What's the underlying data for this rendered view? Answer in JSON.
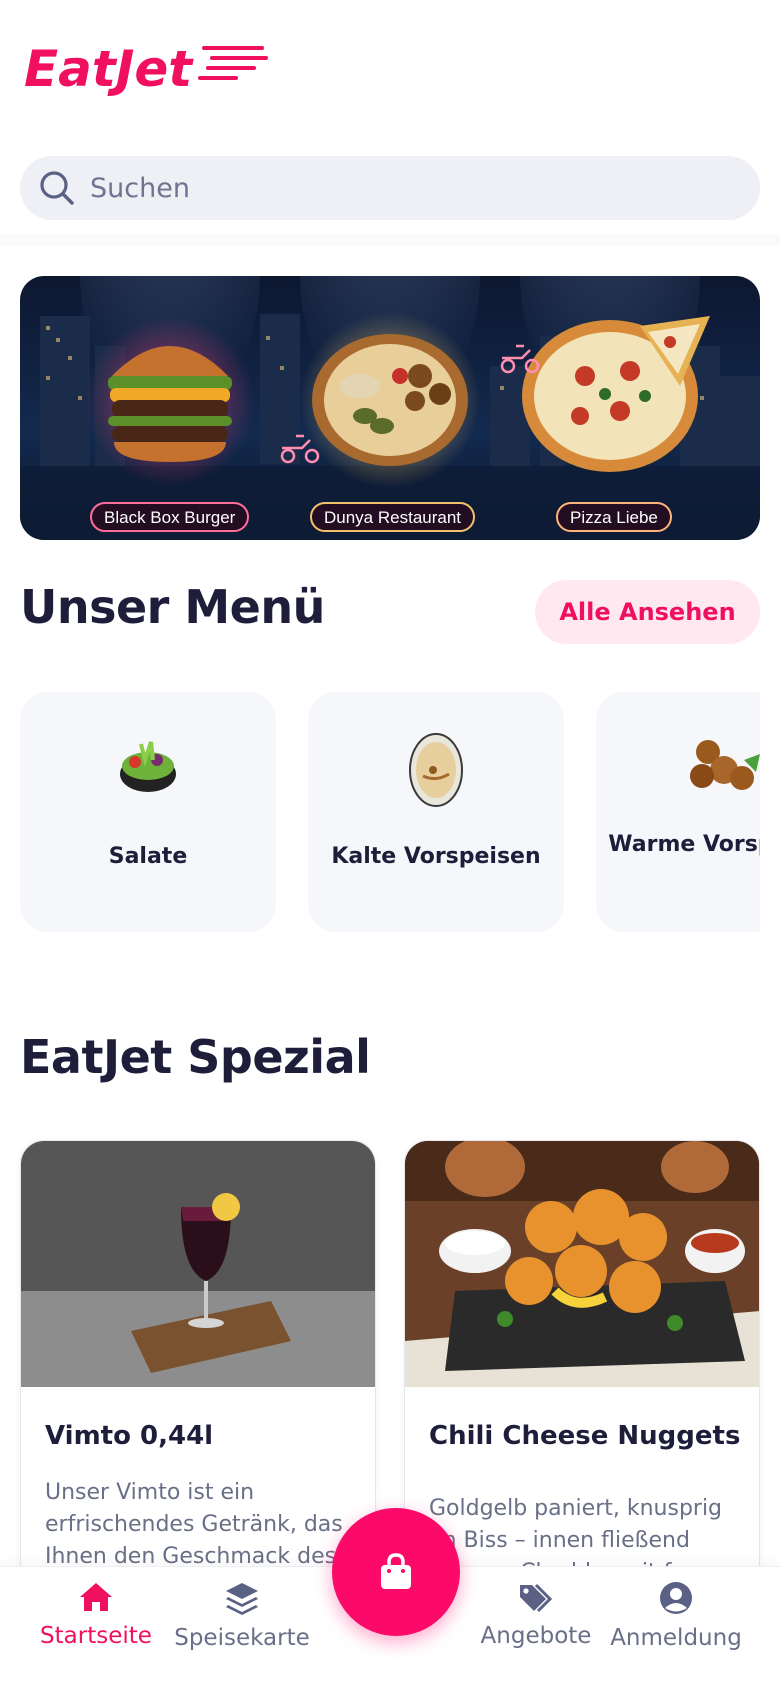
{
  "brand": {
    "logo_text": "EatJet",
    "accent": "#f0105f"
  },
  "search": {
    "placeholder": "Suchen",
    "icon": "search-icon"
  },
  "banner": {
    "labels": [
      "Black Box Burger",
      "Dunya Restaurant",
      "Pizza Liebe"
    ]
  },
  "menu": {
    "title": "Unser Menü",
    "see_all": "Alle Ansehen",
    "categories": [
      {
        "label": "Salate"
      },
      {
        "label": "Kalte Vorspeisen"
      },
      {
        "label": "Warme Vorspeisen"
      }
    ]
  },
  "special": {
    "title": "EatJet Spezial",
    "items": [
      {
        "name": "Vimto 0,44l",
        "desc": "Unser Vimto ist ein erfrischendes Getränk, das Ihnen den Geschmack des"
      },
      {
        "name": "Chili Cheese Nuggets",
        "desc": "Goldgelb paniert, knusprig im Biss – innen fließend warmer Cheddar mit feur"
      }
    ]
  },
  "nav": {
    "items": [
      {
        "label": "Startseite",
        "icon": "home-icon",
        "active": true
      },
      {
        "label": "Speisekarte",
        "icon": "layers-icon",
        "active": false
      },
      {
        "label": "Angebote",
        "icon": "tags-icon",
        "active": false
      },
      {
        "label": "Anmeldung",
        "icon": "user-circle-icon",
        "active": false
      }
    ],
    "cart_icon": "shopping-bag-icon"
  }
}
